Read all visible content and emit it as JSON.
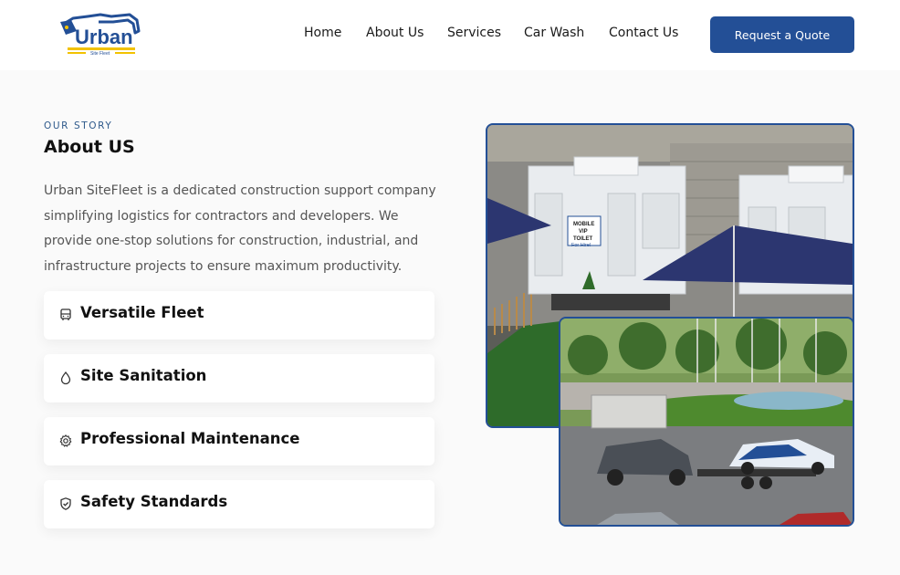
{
  "header": {
    "logo_text": "Urban",
    "logo_subtext": "Site Fleet",
    "nav": [
      {
        "label": "Home"
      },
      {
        "label": "About Us"
      },
      {
        "label": "Services"
      },
      {
        "label": "Car Wash"
      },
      {
        "label": "Contact Us"
      }
    ],
    "cta_label": "Request a Quote"
  },
  "about": {
    "eyebrow": "OUR STORY",
    "title": "About US",
    "description": "Urban SiteFleet is a dedicated construction support company simplifying logistics for contractors and developers. We provide one-stop solutions for construction, industrial, and infrastructure projects to ensure maximum productivity.",
    "features": [
      {
        "label": "Versatile Fleet",
        "icon": "bus-icon"
      },
      {
        "label": "Site Sanitation",
        "icon": "droplet-icon"
      },
      {
        "label": "Professional Maintenance",
        "icon": "gear-icon"
      },
      {
        "label": "Safety Standards",
        "icon": "shield-check-icon"
      }
    ]
  },
  "images": {
    "primary_text": [
      "MOBILE",
      "VIP",
      "TOILET",
      "For Hire!"
    ],
    "primary_icon": "mobile-toilets-photo",
    "secondary_icon": "car-transport-photo"
  },
  "colors": {
    "brand": "#234f96",
    "eyebrow": "#2f5a8c",
    "text_muted": "#555555"
  }
}
